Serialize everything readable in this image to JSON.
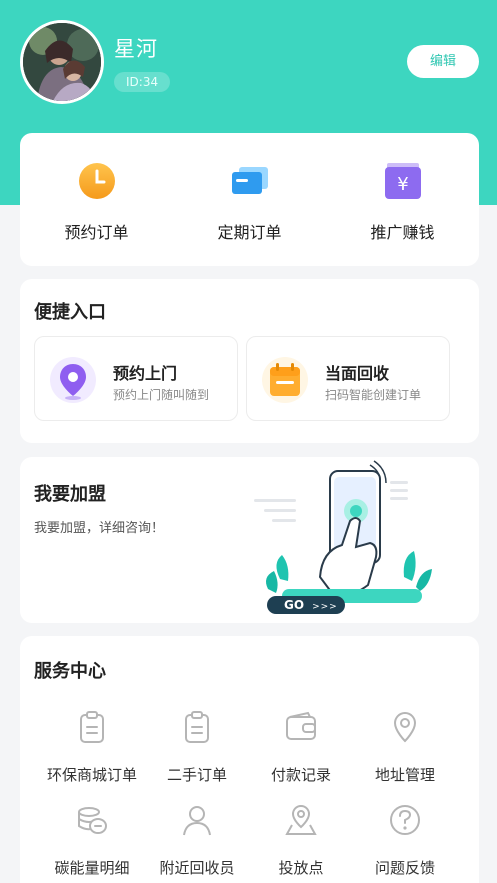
{
  "header": {
    "username": "星河",
    "user_id": "ID:34",
    "edit_label": "编辑",
    "accent_color": "#3dd6c0"
  },
  "orders": [
    {
      "label": "预约订单",
      "icon": "clock-icon"
    },
    {
      "label": "定期订单",
      "icon": "cards-icon"
    },
    {
      "label": "推广赚钱",
      "icon": "yen-wallet-icon"
    }
  ],
  "quick": {
    "title": "便捷入口",
    "items": [
      {
        "title": "预约上门",
        "subtitle": "预约上门随叫随到",
        "icon": "location-pin-icon"
      },
      {
        "title": "当面回收",
        "subtitle": "扫码智能创建订单",
        "icon": "calendar-icon"
      }
    ]
  },
  "join": {
    "title": "我要加盟",
    "subtitle": "我要加盟，详细咨询！",
    "go_label": "GO",
    "go_arrows": ">>>"
  },
  "service": {
    "title": "服务中心",
    "items": [
      {
        "label": "环保商城订单",
        "icon": "clipboard-icon"
      },
      {
        "label": "二手订单",
        "icon": "clipboard-icon"
      },
      {
        "label": "付款记录",
        "icon": "wallet-icon"
      },
      {
        "label": "地址管理",
        "icon": "location-pin-icon"
      },
      {
        "label": "碳能量明细",
        "icon": "coins-icon"
      },
      {
        "label": "附近回收员",
        "icon": "person-icon"
      },
      {
        "label": "投放点",
        "icon": "map-pin-icon"
      },
      {
        "label": "问题反馈",
        "icon": "question-icon"
      }
    ]
  }
}
